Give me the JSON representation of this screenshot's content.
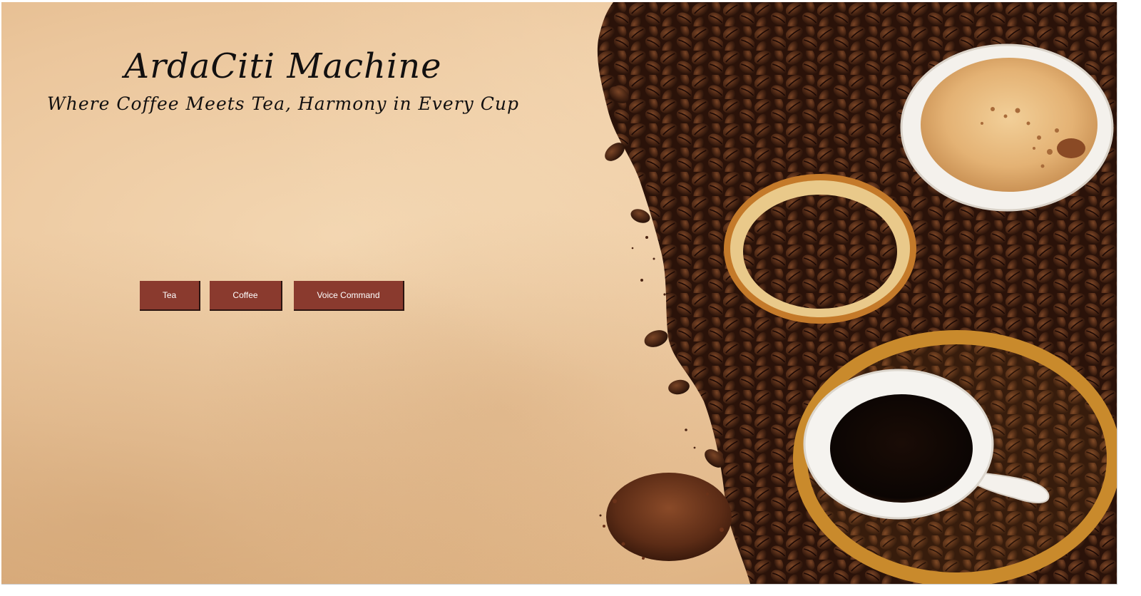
{
  "app": {
    "title": "ArdaCiti Machine",
    "tagline": "Where Coffee Meets Tea, Harmony in Every Cup"
  },
  "buttons": {
    "tea_label": "Tea",
    "coffee_label": "Coffee",
    "voice_label": "Voice Command"
  },
  "colors": {
    "button_bg": "#8a3a2e",
    "button_text": "#ffffff",
    "title_text": "#121010",
    "paper_bg": "#ebc69c"
  },
  "decor": {
    "image_subject": "coffee beans with cups of latte, bean bowl, black coffee and ground coffee"
  }
}
